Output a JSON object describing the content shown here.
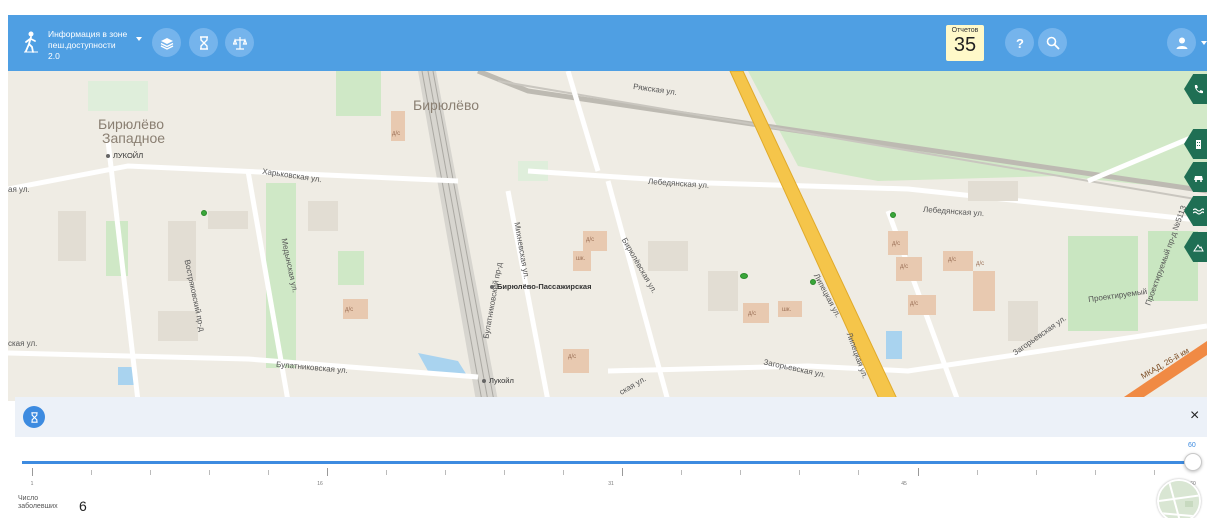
{
  "header": {
    "title_line1": "Информация в зоне",
    "title_line2": "пеш.доступности 2.0",
    "tools": [
      "layers-icon",
      "hourglass-icon",
      "balance-icon"
    ],
    "reports_label": "Отчетов",
    "reports_count": "35",
    "right_icons": [
      "help-icon",
      "search-icon",
      "user-icon"
    ]
  },
  "map": {
    "districts": [
      "Бирюлёво",
      "Западное",
      "Бирюлёво"
    ],
    "streets": [
      "Харьковская ул.",
      "Лебедянская ул.",
      "Лебедянская ул.",
      "Ряжская ул.",
      "Булатниковская ул.",
      "Загорьевская ул.",
      "Загорьевская ул.",
      "Бирюлёвская ул.",
      "Медынская ул.",
      "Востряковский пр-д",
      "Булатниковский пр-д",
      "Михневская ул.",
      "Липецкая ул.",
      "Липецкая ул.",
      "Проектируемый пр-д №5113",
      "Проектируемый",
      "ская ул.",
      "ская ул.",
      "ая ул.",
      "МКАД, 26-й км"
    ],
    "pois": [
      "ЛУКОЙЛ",
      "Бирюлёво-Пассажирская",
      "Лукойл"
    ],
    "building_labels": [
      "д/с",
      "шк.",
      "д/с",
      "д/с",
      "шк.",
      "д/с",
      "д/с",
      "д/с",
      "д/с",
      "д/с",
      "д/с",
      "д/с"
    ],
    "side_tools": [
      "phone-icon",
      "building-icon",
      "car-icon",
      "wave-icon",
      "mountain-icon"
    ],
    "colors": {
      "park": "#c9e6c1",
      "road_major": "#f5c54a",
      "road_mkad": "#f08a44",
      "water": "#a9d3ef",
      "building": "#e8c9b0",
      "marker": "#3aa63a"
    }
  },
  "panel": {
    "close": "×",
    "slider_value": "60",
    "slider": {
      "min": 1,
      "max": 60,
      "value": 60
    },
    "tick_labels": [
      "1",
      "16",
      "31",
      "45",
      "60"
    ],
    "count_label_line1": "Число",
    "count_label_line2": "заболевших",
    "count_value": "6"
  },
  "theme": {
    "accent": "#4f9fe3",
    "button": "#75b4ec",
    "reports_bg": "#fff9c9",
    "slider": "#3d8be0"
  }
}
